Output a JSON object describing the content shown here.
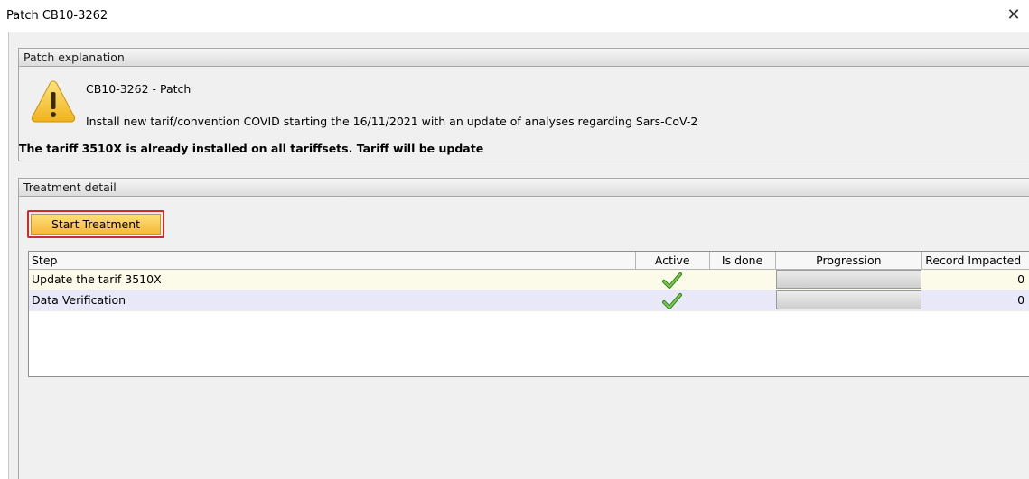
{
  "window": {
    "title": "Patch CB10-3262",
    "close_icon": "close-icon"
  },
  "explanation": {
    "header": "Patch explanation",
    "icon": "warning-icon",
    "patch_name": "CB10-3262 - Patch",
    "description": "Install new tarif/convention COVID starting the 16/11/2021 with an update of analyses regarding Sars-CoV-2",
    "status": "The tariff 3510X is already installed on all tariffsets. Tariff will be update"
  },
  "treatment": {
    "header": "Treatment detail",
    "start_button": "Start Treatment",
    "columns": [
      "Step",
      "Active",
      "Is done",
      "Progression",
      "Record Impacted"
    ],
    "rows": [
      {
        "step": "Update the tarif 3510X",
        "active": true,
        "is_done": "",
        "progress": 0,
        "records": "0"
      },
      {
        "step": "Data Verification",
        "active": true,
        "is_done": "",
        "progress": 0,
        "records": "0"
      }
    ]
  },
  "colors": {
    "accent_button": "#f5b93a",
    "highlight_border": "#d12a2a",
    "check_green": "#3c9a2a",
    "warning_yellow": "#f4c12c"
  }
}
